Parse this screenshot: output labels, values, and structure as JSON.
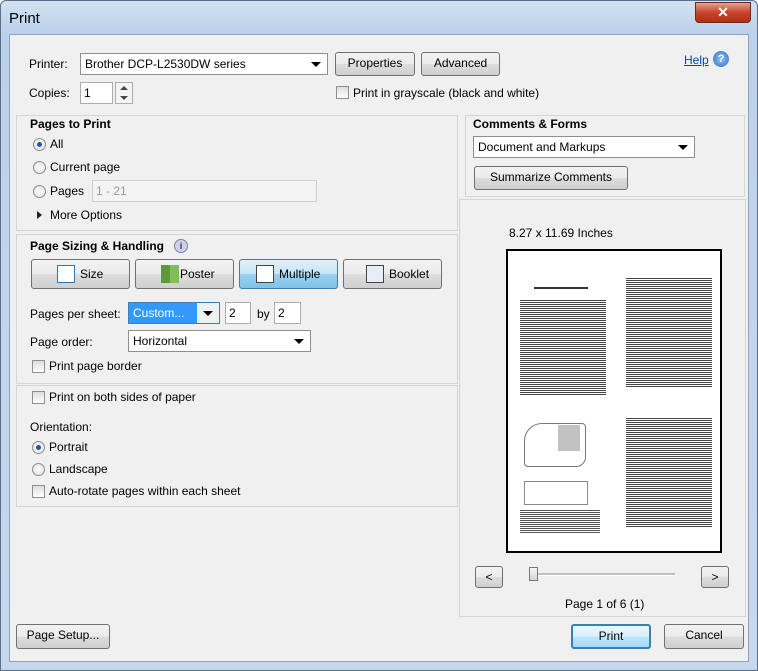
{
  "window": {
    "title": "Print",
    "close_glyph": "✕"
  },
  "printer": {
    "label": "Printer:",
    "value": "Brother DCP-L2530DW series",
    "properties": "Properties",
    "advanced": "Advanced",
    "help": "Help"
  },
  "copies": {
    "label": "Copies:",
    "value": "1"
  },
  "grayscale": {
    "label": "Print in grayscale (black and white)",
    "checked": false
  },
  "pages_to_print": {
    "heading": "Pages to Print",
    "all": "All",
    "current": "Current page",
    "pages": "Pages",
    "pages_range": "1 - 21",
    "more": "More Options",
    "selected": "All"
  },
  "sizing": {
    "heading": "Page Sizing & Handling",
    "modes": [
      "Size",
      "Poster",
      "Multiple",
      "Booklet"
    ],
    "active_mode": "Multiple",
    "pps_label": "Pages per sheet:",
    "pps_value": "Custom...",
    "pps_x": "2",
    "by": "by",
    "pps_y": "2",
    "order_label": "Page order:",
    "order_value": "Horizontal",
    "border_label": "Print page border"
  },
  "duplex": {
    "label": "Print on both sides of paper"
  },
  "orientation": {
    "label": "Orientation:",
    "portrait": "Portrait",
    "landscape": "Landscape",
    "autorotate": "Auto-rotate pages within each sheet",
    "selected": "Portrait"
  },
  "comments": {
    "heading": "Comments & Forms",
    "value": "Document and Markups",
    "summarize": "Summarize Comments"
  },
  "preview": {
    "size": "8.27 x 11.69 Inches",
    "page_info": "Page 1 of 6 (1)",
    "prev": "<",
    "next": ">"
  },
  "bottom": {
    "page_setup": "Page Setup...",
    "print": "Print",
    "cancel": "Cancel"
  },
  "colors": {
    "accent": "#1c5aa6",
    "link": "#0645ad"
  }
}
